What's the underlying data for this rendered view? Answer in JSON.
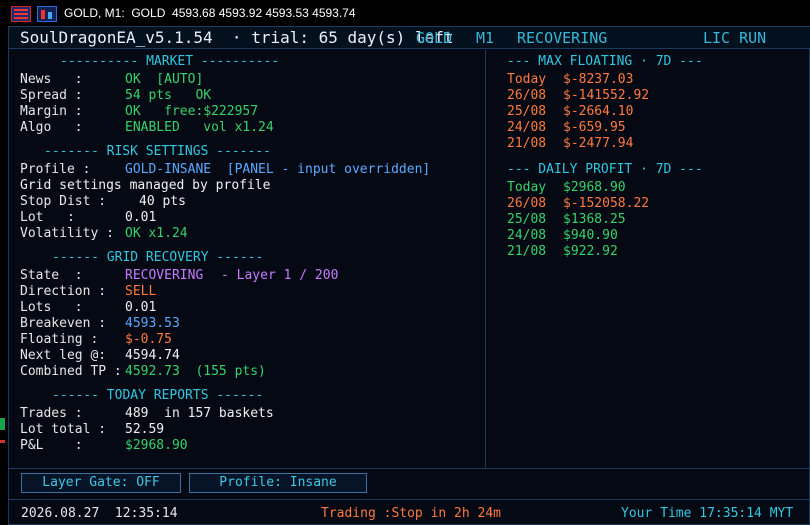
{
  "toolbar": {
    "text": "GOLD, M1:  GOLD  4593.68 4593.92 4593.53 4593.74",
    "icons": [
      "chart-bars-icon",
      "candles-icon"
    ]
  },
  "header": {
    "title": "SoulDragonEA_v5.1.54  · trial: 65 day(s) left",
    "symbol": "GOLD",
    "timeframe": "M1",
    "state": "RECOVERING",
    "license": "LIC RUN"
  },
  "market": {
    "title": "---------- MARKET ----------",
    "rows": [
      {
        "label": "News   :",
        "value": "OK  [AUTO]"
      },
      {
        "label": "Spread :",
        "value": "54 pts   OK"
      },
      {
        "label": "Margin :",
        "value": "OK   free:$222957"
      },
      {
        "label": "Algo   :",
        "value": "ENABLED   vol x1.24"
      }
    ]
  },
  "risk": {
    "title": "------- RISK SETTINGS -------",
    "profile_label": "Profile :",
    "profile_value": "GOLD-INSANE  [PANEL - input overridden]",
    "note": "Grid settings managed by profile",
    "stop_label": "Stop Dist :",
    "stop_value": "40 pts",
    "lot_label": "Lot   :",
    "lot_value": "0.01",
    "vol_label": "Volatility :",
    "vol_value": "OK x1.24"
  },
  "grid": {
    "title": "------ GRID RECOVERY ------",
    "state_label": "State  :",
    "state_value": "RECOVERING",
    "layer": "- Layer 1 / 200",
    "direction_label": "Direction :",
    "direction_value": "SELL",
    "lots_label": "Lots   :",
    "lots_value": "0.01",
    "breakeven_label": "Breakeven :",
    "breakeven_value": "4593.53",
    "floating_label": "Floating :",
    "floating_value": "$-0.75",
    "nextleg_label": "Next leg @:",
    "nextleg_value": "4594.74",
    "tp_label": "Combined TP :",
    "tp_value": "4592.73  (155 pts)"
  },
  "today": {
    "title": "------ TODAY REPORTS ------",
    "trades_label": "Trades :",
    "trades_value": "489  in 157 baskets",
    "lot_label": "Lot total :",
    "lot_value": "52.59",
    "pnl_label": "P&L    :",
    "pnl_value": "$2968.90"
  },
  "max_floating": {
    "title": "--- MAX FLOATING · 7D ---",
    "rows": [
      {
        "date": "Today",
        "value": "$-8237.03"
      },
      {
        "date": "26/08",
        "value": "$-141552.92"
      },
      {
        "date": "25/08",
        "value": "$-2664.10"
      },
      {
        "date": "24/08",
        "value": "$-659.95"
      },
      {
        "date": "21/08",
        "value": "$-2477.94"
      }
    ]
  },
  "daily_profit": {
    "title": "--- DAILY PROFIT · 7D ---",
    "rows": [
      {
        "date": "Today",
        "value": "$2968.90"
      },
      {
        "date": "26/08",
        "value": "$-152058.22"
      },
      {
        "date": "25/08",
        "value": "$1368.25"
      },
      {
        "date": "24/08",
        "value": "$940.90"
      },
      {
        "date": "21/08",
        "value": "$922.92"
      }
    ]
  },
  "buttons": {
    "layer_gate": "Layer Gate: OFF",
    "profile": "Profile: Insane"
  },
  "footer": {
    "datetime": "2026.08.27  12:35:14",
    "trading": "Trading :Stop in 2h 24m",
    "user_time": "Your Time 17:35:14 MYT"
  },
  "colors": {
    "accent": "#2fc8e0",
    "positive": "#35d36b",
    "negative": "#ff7a3c",
    "info": "#5aa9ff",
    "purple": "#c77bff"
  }
}
